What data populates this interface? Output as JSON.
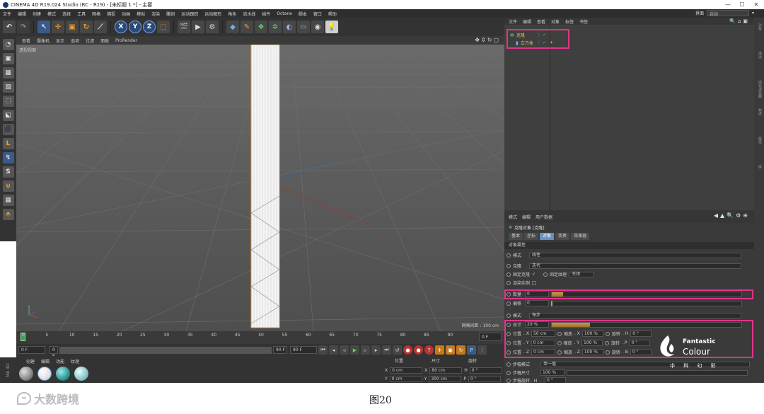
{
  "window": {
    "title": "CINEMA 4D R19.024 Studio (RC - R19) - [未标题 1 *] - 主要",
    "controls": [
      "—",
      "☐",
      "✕"
    ]
  },
  "menubar": {
    "items": [
      "文件",
      "编辑",
      "创建",
      "模式",
      "选择",
      "工具",
      "网格",
      "捕捉",
      "动画",
      "模拟",
      "渲染",
      "雕刻",
      "运动跟踪",
      "运动图形",
      "角色",
      "流水线",
      "插件",
      "Octane",
      "脚本",
      "窗口",
      "帮助"
    ],
    "layout_label": "界面",
    "layout_value": "启动"
  },
  "viewport": {
    "menu": [
      "查看",
      "摄像机",
      "显示",
      "选项",
      "过滤",
      "面板",
      "ProRender"
    ],
    "label": "透视视图",
    "grid_info": "网格间距 : 100 cm"
  },
  "timeline": {
    "ticks": [
      "0",
      "5",
      "10",
      "15",
      "20",
      "25",
      "30",
      "35",
      "40",
      "45",
      "50",
      "55",
      "60",
      "65",
      "70",
      "75",
      "80",
      "85",
      "90"
    ],
    "end_frame": "0 F"
  },
  "playback": {
    "current": "0 F",
    "start": "0 F",
    "range_end": "90 F",
    "end": "90 F"
  },
  "materials": {
    "tabs": [
      "创建",
      "编辑",
      "功能",
      "纹理"
    ]
  },
  "coordinates": {
    "headers": [
      "位置",
      "尺寸",
      "旋转"
    ],
    "rows": [
      {
        "axis": "X",
        "pos": "0 cm",
        "size_axis": "X",
        "size": "80 cm",
        "rot_axis": "H",
        "rot": "0 °"
      },
      {
        "axis": "Y",
        "pos": "0 cm",
        "size_axis": "Y",
        "size": "300 cm",
        "rot_axis": "P",
        "rot": "0 °"
      }
    ]
  },
  "object_manager": {
    "menu": [
      "文件",
      "编辑",
      "查看",
      "对象",
      "标签",
      "书签"
    ],
    "objects": [
      {
        "name": "克隆"
      },
      {
        "name": "立方体"
      }
    ]
  },
  "right_tabs": [
    "对象",
    "场次",
    "内容浏览器",
    "构造",
    "属性",
    "层"
  ],
  "attributes": {
    "menu": [
      "模式",
      "编辑",
      "用户数据"
    ],
    "title": "克隆对象 [克隆]",
    "tabs": [
      "基本",
      "坐标",
      "对象",
      "变换",
      "效果器"
    ],
    "active_tab": "对象",
    "section": "对象属性",
    "mode_label": "模式",
    "mode_value": "线性",
    "clone_label": "克隆",
    "clone_value": "迭代",
    "fix_clone_label": "固定克隆",
    "fix_texture_label": "固定纹理",
    "fix_texture_value": "关闭",
    "render_instance_label": "渲染实例",
    "count_label": "数量",
    "count_value": "0",
    "count_fraction": 0.06,
    "offset_label": "偏移",
    "offset_value": "0",
    "mode2_label": "模式",
    "mode2_value": "每步",
    "total_label": "总计",
    "total_value": "20 %",
    "total_fraction": 0.2,
    "pos_label": "位置",
    "scale_label": "缩放",
    "rot_label": "旋转",
    "pos_x": "50 cm",
    "pos_y": "0 cm",
    "pos_z": "0 cm",
    "scale_x": "100 %",
    "scale_y": "100 %",
    "scale_z": "100 %",
    "rot_h": "0 °",
    "rot_p": "0 °",
    "rot_b": "0 °",
    "step_mode_label": "步幅模式",
    "step_mode_value": "单一值",
    "step_size_label": "步幅尺寸",
    "step_size_value": "100 %",
    "step_rot_label": "步幅旋转 . H",
    "step_rot_value": "0 °"
  },
  "logo": {
    "line1": "Fantastic",
    "line2": "Colour",
    "cn": "中 科 幻 彩"
  },
  "caption": "图20",
  "watermark": "大数跨境"
}
